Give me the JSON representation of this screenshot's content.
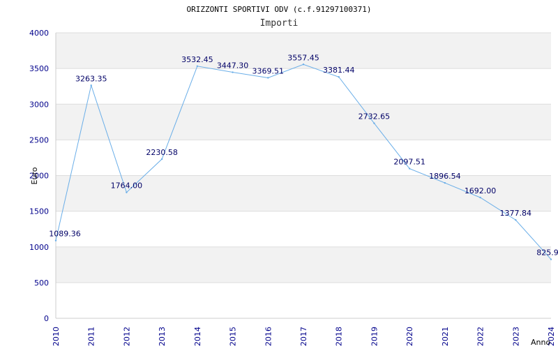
{
  "chart_data": {
    "type": "line",
    "title": "ORIZZONTI SPORTIVI ODV (c.f.91297100371)",
    "subtitle": "Importi",
    "xlabel": "Anno",
    "ylabel": "Euro",
    "categories": [
      "2010",
      "2011",
      "2012",
      "2013",
      "2014",
      "2015",
      "2016",
      "2017",
      "2018",
      "2019",
      "2020",
      "2021",
      "2022",
      "2023",
      "2024"
    ],
    "values": [
      1089.36,
      3263.35,
      1764.0,
      2230.58,
      3532.45,
      3447.3,
      3369.51,
      3557.45,
      3381.44,
      2732.65,
      2097.51,
      1896.54,
      1692.0,
      1377.84,
      825.9
    ],
    "value_labels": [
      "1089.36",
      "3263.35",
      "1764.00",
      "2230.58",
      "3532.45",
      "3447.30",
      "3369.51",
      "3557.45",
      "3381.44",
      "2732.65",
      "2097.51",
      "1896.54",
      "1692.00",
      "1377.84",
      "825.9"
    ],
    "yticks": [
      "0",
      "500",
      "1000",
      "1500",
      "2000",
      "2500",
      "3000",
      "3500",
      "4000"
    ],
    "ylim": [
      0,
      4000
    ],
    "grid": true,
    "colors": {
      "line": "#6aaee8",
      "axis_text": "#00008b",
      "label_text": "#000066",
      "band_fill": "#f2f2f2",
      "grid": "#dddddd"
    }
  }
}
